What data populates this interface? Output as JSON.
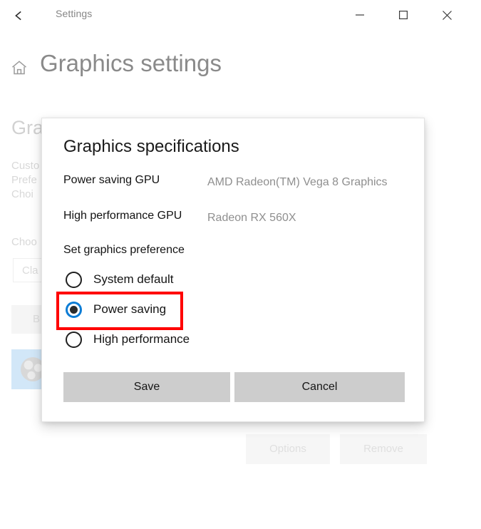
{
  "titlebar": {
    "title": "Settings",
    "back_icon": "back-arrow-icon",
    "minimize_glyph": "–",
    "maximize_glyph": "□",
    "close_glyph": "×"
  },
  "header": {
    "home_icon": "home-icon",
    "title": "Graphics settings"
  },
  "background": {
    "section_title": "Gra",
    "description": "Custo\nPrefe\nChoi",
    "choose_label": "Choo",
    "combo_value": "Cla",
    "browse_button": "B",
    "app_icon": "obs-app-icon",
    "options_button": "Options",
    "remove_button": "Remove"
  },
  "dialog": {
    "title": "Graphics specifications",
    "specs": [
      {
        "label": "Power saving GPU",
        "value": "AMD Radeon(TM) Vega 8 Graphics"
      },
      {
        "label": "High performance GPU",
        "value": "Radeon RX 560X"
      }
    ],
    "preference_label": "Set graphics preference",
    "options": [
      {
        "label": "System default",
        "selected": false
      },
      {
        "label": "Power saving",
        "selected": true
      },
      {
        "label": "High performance",
        "selected": false
      }
    ],
    "save_label": "Save",
    "cancel_label": "Cancel",
    "highlight_color": "#ff0000",
    "accent_color": "#0c7cd5",
    "button_color": "#cdcdcd"
  }
}
